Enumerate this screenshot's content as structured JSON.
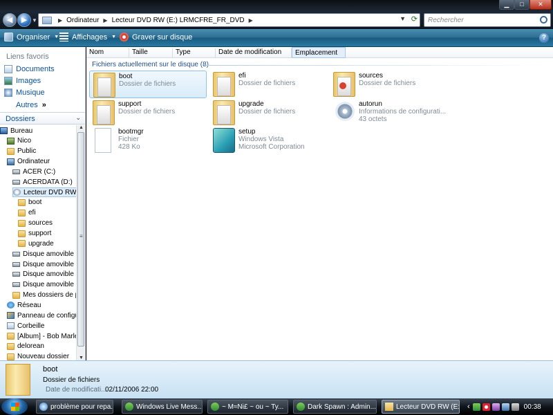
{
  "window": {
    "minimize_glyph": "▁",
    "maximize_glyph": "□",
    "close_glyph": "✕"
  },
  "address": {
    "crumbs": [
      "Ordinateur",
      "Lecteur DVD RW (E:) LRMCFRE_FR_DVD"
    ],
    "search_placeholder": "Rechercher"
  },
  "toolbar": {
    "organize": "Organiser",
    "views": "Affichages",
    "burn": "Graver sur disque",
    "help": "?"
  },
  "favorites": {
    "title": "Liens favoris",
    "items": [
      "Documents",
      "Images",
      "Musique"
    ],
    "more": "Autres",
    "more_glyph": "»"
  },
  "folders_pane": {
    "title": "Dossiers",
    "tree": [
      {
        "label": "Bureau",
        "icon": "desktop"
      },
      {
        "label": "Nico",
        "icon": "user"
      },
      {
        "label": "Public",
        "icon": "folder"
      },
      {
        "label": "Ordinateur",
        "icon": "computer"
      },
      {
        "label": "ACER (C:)",
        "icon": "drive"
      },
      {
        "label": "ACERDATA (D:)",
        "icon": "drive"
      },
      {
        "label": "Lecteur DVD RW (E",
        "icon": "dvd"
      },
      {
        "label": "boot",
        "icon": "folder"
      },
      {
        "label": "efi",
        "icon": "folder"
      },
      {
        "label": "sources",
        "icon": "folder"
      },
      {
        "label": "support",
        "icon": "folder"
      },
      {
        "label": "upgrade",
        "icon": "folder"
      },
      {
        "label": "Disque amovible (I",
        "icon": "drive"
      },
      {
        "label": "Disque amovible (",
        "icon": "drive"
      },
      {
        "label": "Disque amovible (I",
        "icon": "drive"
      },
      {
        "label": "Disque amovible (I",
        "icon": "drive"
      },
      {
        "label": "Mes dossiers de pa",
        "icon": "folder"
      },
      {
        "label": "Réseau",
        "icon": "network"
      },
      {
        "label": "Panneau de configu",
        "icon": "control-panel"
      },
      {
        "label": "Corbeille",
        "icon": "recycle-bin"
      },
      {
        "label": "[Album] - Bob Marle",
        "icon": "folder"
      },
      {
        "label": "delorean",
        "icon": "folder"
      },
      {
        "label": "Nouveau dossier",
        "icon": "folder"
      }
    ]
  },
  "columns": [
    "Nom",
    "Taille",
    "Type",
    "Date de modification",
    "Emplacement"
  ],
  "group_header": "Fichiers actuellement sur le disque (8)",
  "files": [
    {
      "name": "boot",
      "line1": "Dossier de fichiers",
      "line2": "",
      "icon": "folder"
    },
    {
      "name": "efi",
      "line1": "Dossier de fichiers",
      "line2": "",
      "icon": "folder"
    },
    {
      "name": "sources",
      "line1": "Dossier de fichiers",
      "line2": "",
      "icon": "folder-red"
    },
    {
      "name": "support",
      "line1": "Dossier de fichiers",
      "line2": "",
      "icon": "folder"
    },
    {
      "name": "upgrade",
      "line1": "Dossier de fichiers",
      "line2": "",
      "icon": "folder"
    },
    {
      "name": "autorun",
      "line1": "Informations de configurati...",
      "line2": "43 octets",
      "icon": "config-file"
    },
    {
      "name": "bootmgr",
      "line1": "Fichier",
      "line2": "428 Ko",
      "icon": "file"
    },
    {
      "name": "setup",
      "line1": "Windows Vista",
      "line2": "Microsoft Corporation",
      "icon": "setup"
    }
  ],
  "details": {
    "name": "boot",
    "type": "Dossier de fichiers",
    "date_label": "Date de modificati...",
    "date_value": "02/11/2006 22:00"
  },
  "taskbar": {
    "tasks": [
      {
        "label": "problème pour repa...",
        "icon": "ie"
      },
      {
        "label": "Windows Live Mess...",
        "icon": "msn"
      },
      {
        "label": "~ M≈Ni£ ~ ou ~ Ty...",
        "icon": "msn"
      },
      {
        "label": "Dark Spawn : Admin...",
        "icon": "msn"
      },
      {
        "label": "Lecteur DVD RW (E:)...",
        "icon": "folder"
      }
    ],
    "tray_chevron": "‹",
    "clock": "00:38"
  }
}
